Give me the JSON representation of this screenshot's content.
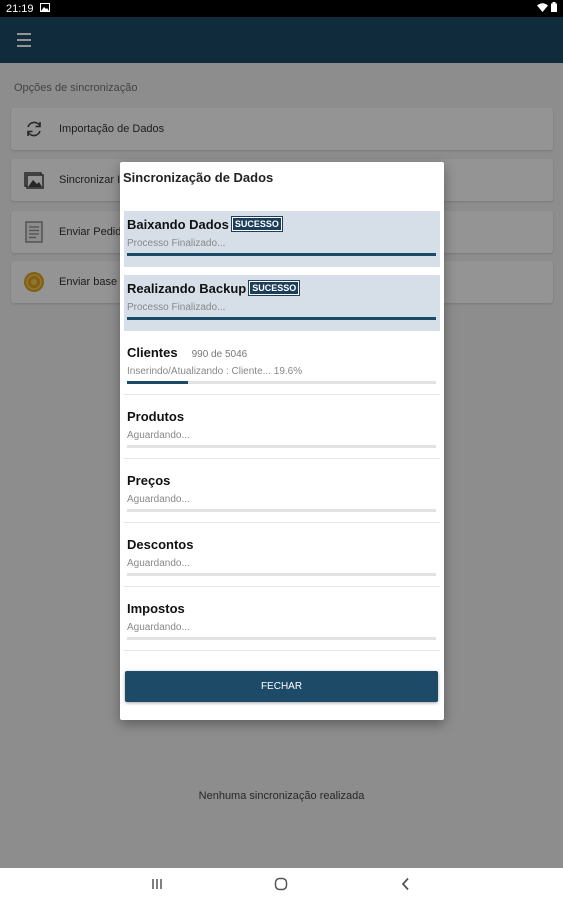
{
  "status_bar": {
    "time": "21:19"
  },
  "screen": {
    "section_label": "Opções de sincronização",
    "options": [
      {
        "label": "Importação de Dados",
        "icon": "sync-icon"
      },
      {
        "label": "Sincronizar I",
        "icon": "images-icon"
      },
      {
        "label": "Enviar Pedido",
        "icon": "document-icon"
      },
      {
        "label": "Enviar base d",
        "icon": "coin-icon"
      }
    ],
    "empty_message": "Nenhuma sincronização realizada"
  },
  "dialog": {
    "title": "Sincronização de Dados",
    "tasks": [
      {
        "name": "Baixando Dados",
        "badge": "SUCESSO",
        "status": "Processo Finalizado...",
        "progress": 1.0,
        "done": true
      },
      {
        "name": "Realizando Backup",
        "badge": "SUCESSO",
        "status": "Processo Finalizado...",
        "progress": 1.0,
        "done": true
      },
      {
        "name": "Clientes",
        "counter": "990 de 5046",
        "status": "Inserindo/Atualizando : Cliente... 19.6%",
        "progress": 0.196,
        "done": false
      },
      {
        "name": "Produtos",
        "status": "Aguardando...",
        "progress": 0,
        "done": false
      },
      {
        "name": "Preços",
        "status": "Aguardando...",
        "progress": 0,
        "done": false
      },
      {
        "name": "Descontos",
        "status": "Aguardando...",
        "progress": 0,
        "done": false
      },
      {
        "name": "Impostos",
        "status": "Aguardando...",
        "progress": 0,
        "done": false
      }
    ],
    "close_label": "FECHAR"
  },
  "colors": {
    "primary": "#1d4a67",
    "done_row": "#d6dfe8",
    "badge": "#1d3e5a"
  }
}
